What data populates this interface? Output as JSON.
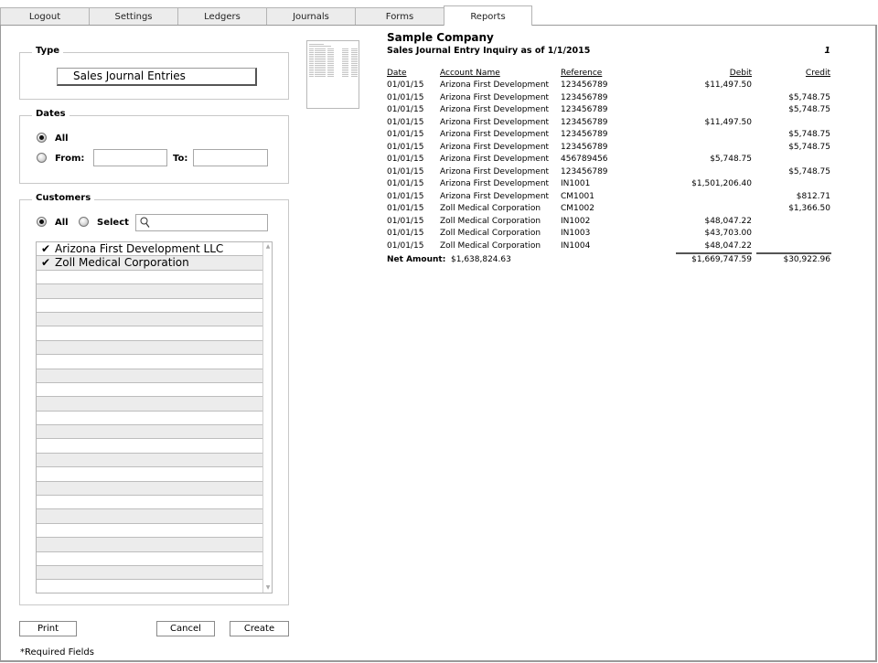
{
  "tabs": [
    {
      "label": "Logout",
      "active": false
    },
    {
      "label": "Settings",
      "active": false
    },
    {
      "label": "Ledgers",
      "active": false
    },
    {
      "label": "Journals",
      "active": false
    },
    {
      "label": "Forms",
      "active": false
    },
    {
      "label": "Reports",
      "active": true
    }
  ],
  "type_group": {
    "legend": "Type",
    "selected": "Sales Journal Entries"
  },
  "dates_group": {
    "legend": "Dates",
    "all_label": "All",
    "from_label": "From:",
    "to_label": "To:",
    "selected": "all",
    "from_value": "",
    "to_value": ""
  },
  "customers_group": {
    "legend": "Customers",
    "all_label": "All",
    "select_label": "Select",
    "selected": "all",
    "search_value": "",
    "search_icon": "search-icon",
    "items": [
      {
        "name": "Arizona First Development LLC",
        "checked": true
      },
      {
        "name": "Zoll Medical Corporation",
        "checked": true
      }
    ]
  },
  "buttons": {
    "print": "Print",
    "cancel": "Cancel",
    "create": "Create"
  },
  "required_note": "*Required Fields",
  "report": {
    "company": "Sample Company",
    "subtitle": "Sales Journal Entry Inquiry as of 1/1/2015",
    "page_number": "1",
    "headers": {
      "date": "Date",
      "account": "Account Name",
      "reference": "Reference",
      "debit": "Debit",
      "credit": "Credit"
    },
    "rows": [
      {
        "date": "01/01/15",
        "account": "Arizona First Development",
        "reference": "123456789",
        "debit": "$11,497.50",
        "credit": ""
      },
      {
        "date": "01/01/15",
        "account": "Arizona First Development",
        "reference": "123456789",
        "debit": "",
        "credit": "$5,748.75"
      },
      {
        "date": "01/01/15",
        "account": "Arizona First Development",
        "reference": "123456789",
        "debit": "",
        "credit": "$5,748.75"
      },
      {
        "date": "01/01/15",
        "account": "Arizona First Development",
        "reference": "123456789",
        "debit": "$11,497.50",
        "credit": ""
      },
      {
        "date": "01/01/15",
        "account": "Arizona First Development",
        "reference": "123456789",
        "debit": "",
        "credit": "$5,748.75"
      },
      {
        "date": "01/01/15",
        "account": "Arizona First Development",
        "reference": "123456789",
        "debit": "",
        "credit": "$5,748.75"
      },
      {
        "date": "01/01/15",
        "account": "Arizona First Development",
        "reference": "456789456",
        "debit": "$5,748.75",
        "credit": ""
      },
      {
        "date": "01/01/15",
        "account": "Arizona First Development",
        "reference": "123456789",
        "debit": "",
        "credit": "$5,748.75"
      },
      {
        "date": "01/01/15",
        "account": "Arizona First Development",
        "reference": "IN1001",
        "debit": "$1,501,206.40",
        "credit": ""
      },
      {
        "date": "01/01/15",
        "account": "Arizona First Development",
        "reference": "CM1001",
        "debit": "",
        "credit": "$812.71"
      },
      {
        "date": "01/01/15",
        "account": "Zoll Medical Corporation",
        "reference": "CM1002",
        "debit": "",
        "credit": "$1,366.50"
      },
      {
        "date": "01/01/15",
        "account": "Zoll Medical Corporation",
        "reference": "IN1002",
        "debit": "$48,047.22",
        "credit": ""
      },
      {
        "date": "01/01/15",
        "account": "Zoll Medical Corporation",
        "reference": "IN1003",
        "debit": "$43,703.00",
        "credit": ""
      },
      {
        "date": "01/01/15",
        "account": "Zoll Medical Corporation",
        "reference": "IN1004",
        "debit": "$48,047.22",
        "credit": ""
      }
    ],
    "net_amount_label": "Net Amount:",
    "net_amount": "$1,638,824.63",
    "total_debit": "$1,669,747.59",
    "total_credit": "$30,922.96"
  }
}
